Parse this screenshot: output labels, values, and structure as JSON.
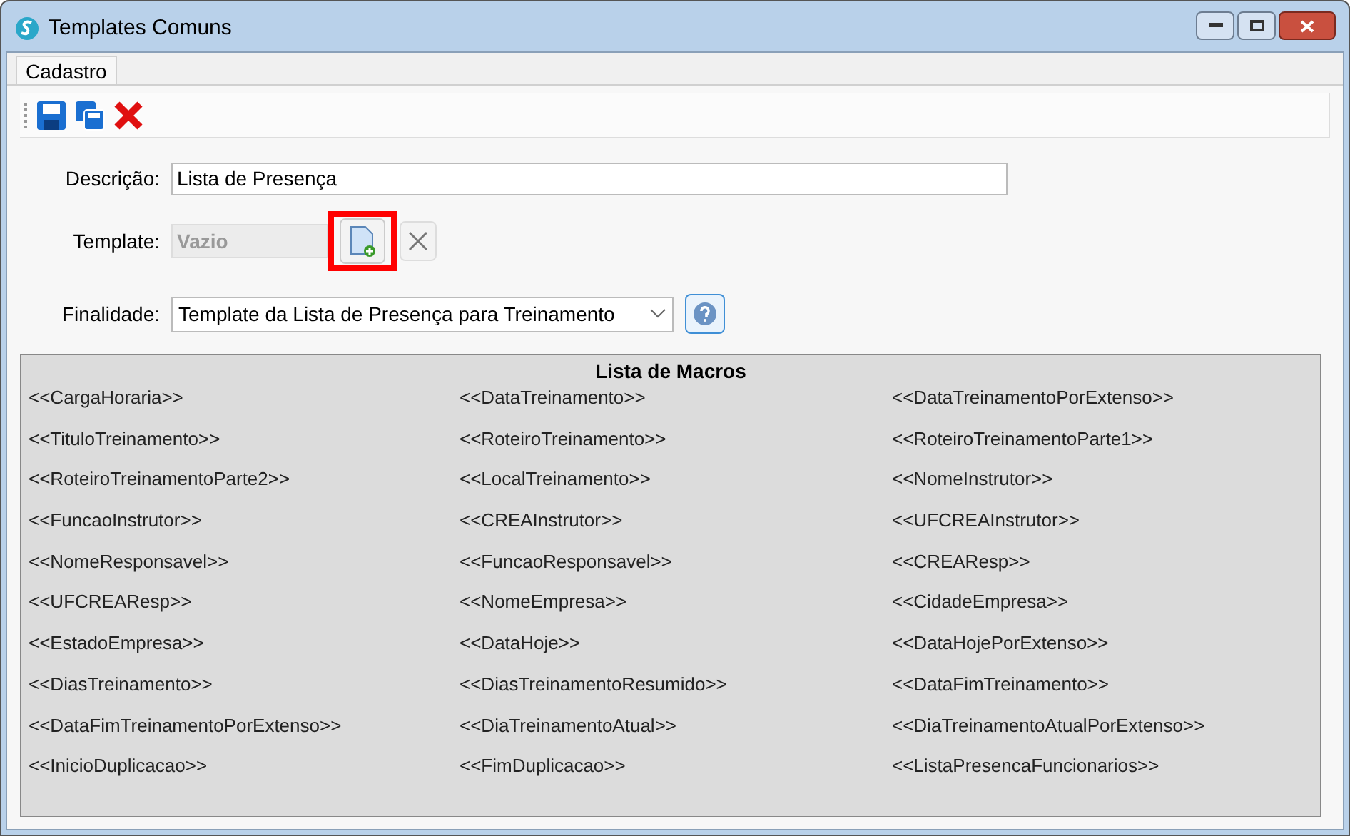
{
  "window": {
    "title": "Templates Comuns"
  },
  "tabs": [
    {
      "label": "Cadastro",
      "selected": true
    }
  ],
  "form": {
    "descricao": {
      "label": "Descrição:",
      "value": "Lista de Presença"
    },
    "template": {
      "label": "Template:",
      "value": "Vazio",
      "disabled": true,
      "add_highlighted": true
    },
    "finalidade": {
      "label": "Finalidade:",
      "value": "Template da Lista de Presença para Treinamento"
    }
  },
  "macros": {
    "title": "Lista de Macros",
    "items": [
      "<<CargaHoraria>>",
      "<<DataTreinamento>>",
      "<<DataTreinamentoPorExtenso>>",
      "<<TituloTreinamento>>",
      "<<RoteiroTreinamento>>",
      "<<RoteiroTreinamentoParte1>>",
      "<<RoteiroTreinamentoParte2>>",
      "<<LocalTreinamento>>",
      "<<NomeInstrutor>>",
      "<<FuncaoInstrutor>>",
      "<<CREAInstrutor>>",
      "<<UFCREAInstrutor>>",
      "<<NomeResponsavel>>",
      "<<FuncaoResponsavel>>",
      "<<CREAResp>>",
      "<<UFCREAResp>>",
      "<<NomeEmpresa>>",
      "<<CidadeEmpresa>>",
      "<<EstadoEmpresa>>",
      "<<DataHoje>>",
      "<<DataHojePorExtenso>>",
      "<<DiasTreinamento>>",
      "<<DiasTreinamentoResumido>>",
      "<<DataFimTreinamento>>",
      "<<DataFimTreinamentoPorExtenso>>",
      "<<DiaTreinamentoAtual>>",
      "<<DiaTreinamentoAtualPorExtenso>>",
      "<<InicioDuplicacao>>",
      "<<FimDuplicacao>>",
      "<<ListaPresencaFuncionarios>>"
    ]
  }
}
